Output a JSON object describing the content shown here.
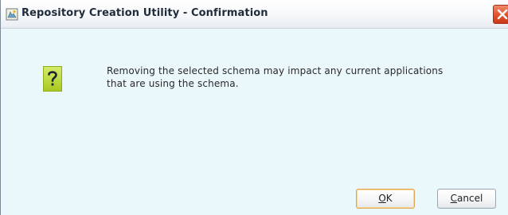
{
  "window": {
    "title": "Repository Creation Utility - Confirmation"
  },
  "dialog": {
    "icon": "question-icon",
    "message_line1": "Removing the selected schema may impact any current applications",
    "message_line2": "that are using the schema."
  },
  "buttons": {
    "ok_mnemonic": "O",
    "ok_rest": "K",
    "cancel_mnemonic": "C",
    "cancel_rest": "ancel"
  },
  "colors": {
    "background": "#eaf8fb",
    "question_badge": "#b7d832",
    "close_button": "#e2502d",
    "default_button_border": "#e0a24a"
  }
}
